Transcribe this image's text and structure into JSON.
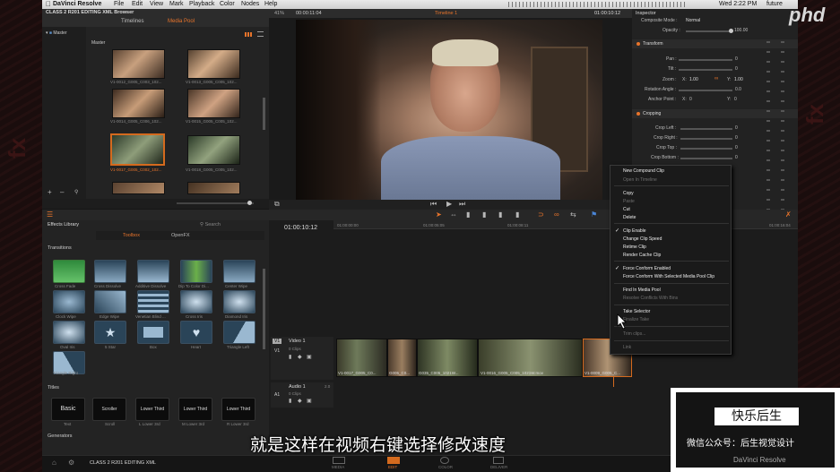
{
  "menubar": {
    "app": "DaVinci Resolve",
    "items": [
      "File",
      "Edit",
      "View",
      "Mark",
      "Playback",
      "Color",
      "Nodes",
      "Help"
    ],
    "time": "Wed 2:22 PM",
    "user": "future"
  },
  "project": {
    "title": "CLASS 2 R201 EDITING XML Browser",
    "bottom_title": "CLASS 2 R201 EDITING XML"
  },
  "media_pool": {
    "tabs": [
      "Timelines",
      "Media Pool"
    ],
    "bin": "Master",
    "folder": "Master",
    "clips": [
      "V1-0012_G005_C003_102...",
      "V1-0013_G005_C005_102...",
      "V1-0014_G005_C006_102...",
      "V1-0015_G005_C005_102...",
      "V1-0017_G005_C002_102...",
      "V1-0018_G005_C005_102..."
    ]
  },
  "viewer": {
    "zoom": "41%",
    "source_tc": "00:00:11:04",
    "timeline": "Timeline 1",
    "record_tc": "01:00:10:12"
  },
  "inspector": {
    "title": "Inspector",
    "composite_mode_label": "Composite Mode :",
    "composite_mode": "Normal",
    "opacity_label": "Opacity :",
    "opacity": "100.00",
    "transform": "Transform",
    "pan": "Pan :",
    "tilt": "Tilt :",
    "zoom": "Zoom :",
    "zoom_x_label": "X:",
    "zoom_x": "1.00",
    "zoom_y_label": "Y:",
    "zoom_y": "1.00",
    "rotation": "Rotation Angle :",
    "anchor": "Anchor Point :",
    "anchor_x_label": "X:",
    "anchor_y_label": "Y:",
    "cropping": "Cropping",
    "crop_left": "Crop Left :",
    "crop_right": "Crop Right :",
    "crop_top": "Crop Top :",
    "crop_bottom": "Crop Bottom :",
    "zero": "0",
    "zero_dec": "0.0"
  },
  "effects": {
    "title": "Effects Library",
    "search": "Search",
    "tabs": [
      "Toolbox",
      "OpenFX"
    ],
    "transitions_label": "Transitions",
    "transitions": [
      "Cross Fade",
      "Cross Dissolve",
      "Additive Dissolve",
      "Dip To Color Di...",
      "Center Wipe",
      "Clock Wipe",
      "Edge Wipe",
      "Venetian Blind ...",
      "Cross Iris",
      "Diamond Iris",
      "Oval Iris",
      "5 Star",
      "Box",
      "Heart",
      "Triangle Left",
      "Triangle Right"
    ],
    "titles_label": "Titles",
    "titles": [
      {
        "preview": "Basic",
        "name": "Text"
      },
      {
        "preview": "Scroller",
        "name": "Scroll"
      },
      {
        "preview": "Lower Third",
        "name": "L Lower 3rd"
      },
      {
        "preview": "Lower Third",
        "name": "M Lower 3rd"
      },
      {
        "preview": "Lower Third",
        "name": "R Lower 3rd"
      }
    ],
    "generators_label": "Generators"
  },
  "timeline": {
    "tc": "01:00:10:12",
    "ruler": [
      "01:00:00:00",
      "01:00:05:05",
      "01:00:08:11",
      "01:00:16:04"
    ],
    "video_track": {
      "id": "V1",
      "name": "Video 1",
      "count": "0 Clips"
    },
    "audio_track": {
      "id": "A1",
      "name": "Audio 1",
      "count": "0 Clips",
      "level": "2.0"
    },
    "clips": [
      "V1-0017_G005_C0...",
      "G005_C0...",
      "G035_C005_1021W...",
      "V1-0016_G005_C005_1021W.mov",
      "V1-0009_G005_C..."
    ]
  },
  "context_menu": {
    "items": [
      {
        "label": "New Compound Clip",
        "enabled": true,
        "check": false
      },
      {
        "label": "Open In Timeline",
        "enabled": false,
        "check": false
      },
      {
        "label": "Copy",
        "enabled": true,
        "check": false
      },
      {
        "label": "Paste",
        "enabled": false,
        "check": false
      },
      {
        "label": "Cut",
        "enabled": true,
        "check": false
      },
      {
        "label": "Delete",
        "enabled": true,
        "check": false
      },
      {
        "label": "Clip Enable",
        "enabled": true,
        "check": true
      },
      {
        "label": "Change Clip Speed",
        "enabled": true,
        "check": false
      },
      {
        "label": "Retime Clip",
        "enabled": true,
        "check": false
      },
      {
        "label": "Render Cache Clip",
        "enabled": true,
        "check": false
      },
      {
        "label": "Force Conform Enabled",
        "enabled": true,
        "check": true
      },
      {
        "label": "Force Conform With Selected Media Pool Clip",
        "enabled": true,
        "check": false
      },
      {
        "label": "Find In Media Pool",
        "enabled": true,
        "check": false
      },
      {
        "label": "Resolve Conflicts With Bins",
        "enabled": false,
        "check": false
      },
      {
        "label": "Take Selector",
        "enabled": true,
        "check": false
      },
      {
        "label": "Finalize Take",
        "enabled": false,
        "check": false
      },
      {
        "label": "Trim clips...",
        "enabled": false,
        "check": false
      },
      {
        "label": "Link",
        "enabled": false,
        "check": false
      }
    ]
  },
  "pages": [
    "MEDIA",
    "EDIT",
    "COLOR",
    "DELIVER"
  ],
  "active_page": "EDIT",
  "subtitle": "就是这样在视频右键选择修改速度",
  "watermark": {
    "title": "快乐后生",
    "line": "微信公众号：后生视觉设计",
    "brand": "DaVinci Resolve"
  },
  "colors": {
    "accent": "#e8742b",
    "selection": "#d46a1e",
    "menubar": "#dcdcdc"
  }
}
